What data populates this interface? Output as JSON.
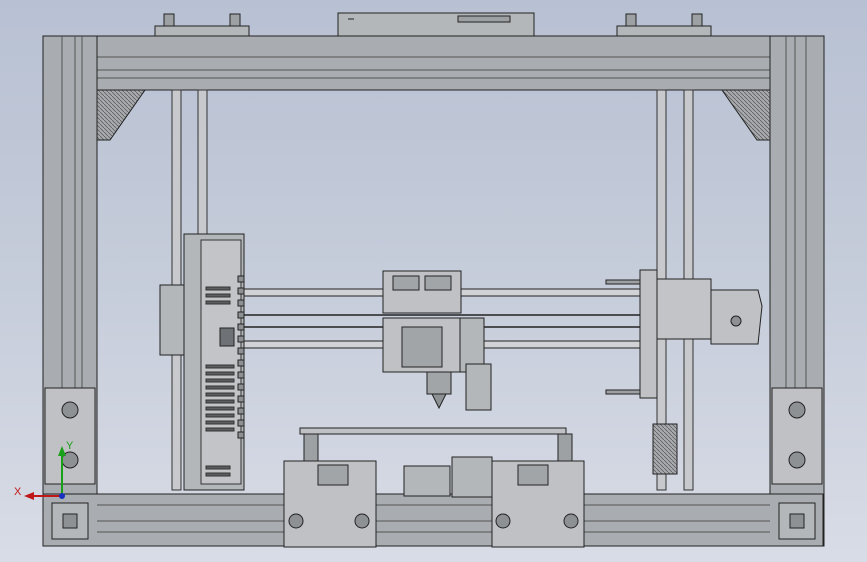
{
  "viewport": {
    "background_top": "#b8c1d3",
    "background_bottom": "#d8dce6"
  },
  "triad": {
    "x_label": "X",
    "y_label": "Y",
    "x_color": "#c01818",
    "y_color": "#18a018",
    "z_color": "#1830c0"
  },
  "model": {
    "frame_color": "#a9acb0",
    "frame_shadow": "#7d8084",
    "part_color": "#bfc1c4",
    "outline_color": "#1e1e1e"
  }
}
